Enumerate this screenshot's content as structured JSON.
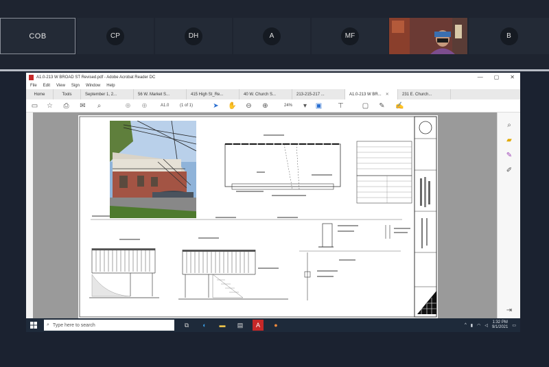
{
  "participants": [
    {
      "initials": "COB",
      "style": "text",
      "active": true
    },
    {
      "initials": "CP",
      "style": "badge",
      "active": false
    },
    {
      "initials": "DH",
      "style": "badge",
      "active": false
    },
    {
      "initials": "A",
      "style": "badge",
      "active": false
    },
    {
      "initials": "MF",
      "style": "badge",
      "active": false
    },
    {
      "initials": "B",
      "style": "badge",
      "active": false
    }
  ],
  "window": {
    "title": "A1.0-213 W BROAD ST Revised.pdf - Adobe Acrobat Reader DC",
    "controls": [
      "—",
      "▢",
      "✕"
    ]
  },
  "menu": [
    "File",
    "Edit",
    "View",
    "Sign",
    "Window",
    "Help"
  ],
  "tabs": {
    "fixed": [
      "Home",
      "Tools"
    ],
    "docs": [
      "September 1, 2...",
      "56 W. Market S...",
      "415 High St_Re...",
      "40 W. Church S...",
      "213-215-217 ...",
      "A1.0-213 W BR...",
      "231 E. Church..."
    ],
    "current_index": 5
  },
  "toolbar": {
    "page_current": "A1.0",
    "page_total": "(1 of 1)",
    "zoom": "24%"
  },
  "taskbar": {
    "search_placeholder": "Type here to search",
    "time": "1:32 PM",
    "date": "9/1/2021"
  },
  "colors": {
    "taskbar": "#1e2a3a",
    "pdf_red": "#c62828",
    "acrobat_blue": "#2a6fd1",
    "call_bg": "#1e2430"
  }
}
